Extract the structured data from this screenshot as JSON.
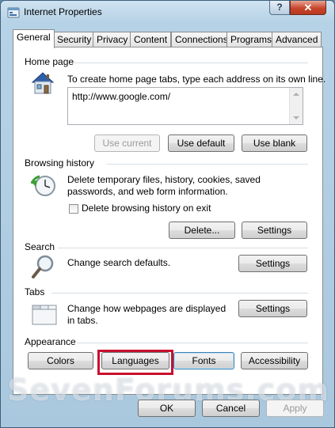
{
  "window": {
    "title": "Internet Properties"
  },
  "titlebar": {
    "help_label": "?",
    "close_label": "✕"
  },
  "tabs": [
    {
      "label": "General",
      "active": true
    },
    {
      "label": "Security"
    },
    {
      "label": "Privacy"
    },
    {
      "label": "Content"
    },
    {
      "label": "Connections"
    },
    {
      "label": "Programs"
    },
    {
      "label": "Advanced"
    }
  ],
  "home_page": {
    "heading": "Home page",
    "description": "To create home page tabs, type each address on its own line.",
    "url_value": "http://www.google.com/",
    "buttons": {
      "use_current": "Use current",
      "use_default": "Use default",
      "use_blank": "Use blank"
    }
  },
  "browsing_history": {
    "heading": "Browsing history",
    "description": "Delete temporary files, history, cookies, saved passwords, and web form information.",
    "checkbox_label": "Delete browsing history on exit",
    "checkbox_checked": false,
    "buttons": {
      "delete": "Delete...",
      "settings": "Settings"
    }
  },
  "search": {
    "heading": "Search",
    "description": "Change search defaults.",
    "buttons": {
      "settings": "Settings"
    }
  },
  "tabs_section": {
    "heading": "Tabs",
    "description": "Change how webpages are displayed in tabs.",
    "buttons": {
      "settings": "Settings"
    }
  },
  "appearance": {
    "heading": "Appearance",
    "buttons": {
      "colors": "Colors",
      "languages": "Languages",
      "fonts": "Fonts",
      "accessibility": "Accessibility"
    }
  },
  "footer": {
    "ok": "OK",
    "cancel": "Cancel",
    "apply": "Apply"
  },
  "watermark": "SevenForums.com",
  "colors": {
    "highlight": "#c8102e",
    "title_bar": "#b6d2e6"
  },
  "icons": [
    "ie-app-icon",
    "home-icon",
    "history-clock-icon",
    "search-magnifier-icon",
    "tabs-window-icon"
  ]
}
